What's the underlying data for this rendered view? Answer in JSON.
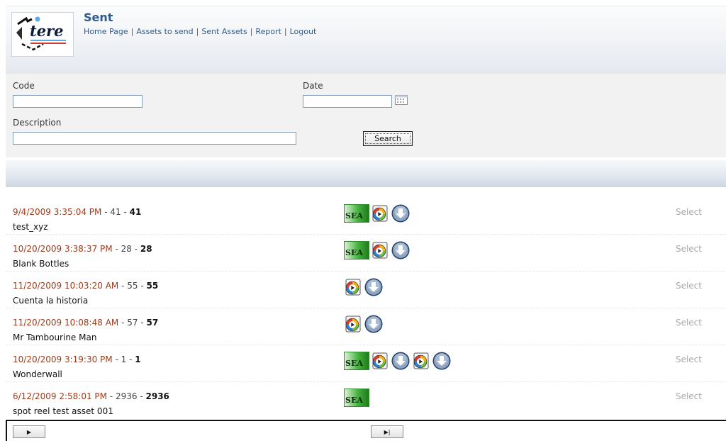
{
  "header": {
    "title": "Sent",
    "logo_text": "tere",
    "nav": [
      "Home Page",
      "Assets to send",
      "Sent Assets",
      "Report",
      "Logout"
    ],
    "nav_separator": "|"
  },
  "search": {
    "code_label": "Code",
    "code_value": "",
    "date_label": "Date",
    "date_value": "",
    "description_label": "Description",
    "description_value": "",
    "search_button": "Search",
    "calendar_icon": "calendar-icon"
  },
  "items": [
    {
      "date": "9/4/2009 3:35:04 PM",
      "sep": " - ",
      "num": "41",
      "sep2": " - ",
      "num_bold": "41",
      "title": "test_xyz",
      "icons": [
        "sea",
        "media",
        "download"
      ],
      "select": "Select"
    },
    {
      "date": "10/20/2009 3:38:37 PM",
      "sep": " - ",
      "num": "28",
      "sep2": " - ",
      "num_bold": "28",
      "title": "Blank Bottles",
      "icons": [
        "sea",
        "media",
        "download"
      ],
      "select": "Select"
    },
    {
      "date": "11/20/2009 10:03:20 AM",
      "sep": " - ",
      "num": "55",
      "sep2": " - ",
      "num_bold": "55",
      "title": "Cuenta la historia",
      "icons": [
        "media",
        "download"
      ],
      "select": "Select"
    },
    {
      "date": "11/20/2009 10:08:48 AM",
      "sep": " - ",
      "num": "57",
      "sep2": " - ",
      "num_bold": "57",
      "title": "Mr Tambourine Man",
      "icons": [
        "media",
        "download"
      ],
      "select": "Select"
    },
    {
      "date": "10/20/2009 3:19:30 PM",
      "sep": " - ",
      "num": "1",
      "sep2": " - ",
      "num_bold": "1",
      "title": "Wonderwall",
      "icons": [
        "sea",
        "media",
        "download",
        "media",
        "download"
      ],
      "select": "Select"
    },
    {
      "date": "6/12/2009 2:58:01 PM",
      "sep": " - ",
      "num": "2936",
      "sep2": " - ",
      "num_bold": "2936",
      "title": "spot reel test asset 001",
      "icons": [
        "sea"
      ],
      "select": "Select"
    }
  ],
  "icon_labels": {
    "sea": "SEA"
  },
  "pager": {
    "next_label": "▶",
    "last_label": "▶|"
  },
  "colors": {
    "title_blue": "#2f5b8c",
    "date_red": "#9b3b1c",
    "select_gray": "#a9a9a9",
    "sea_green": "#46b23f"
  }
}
